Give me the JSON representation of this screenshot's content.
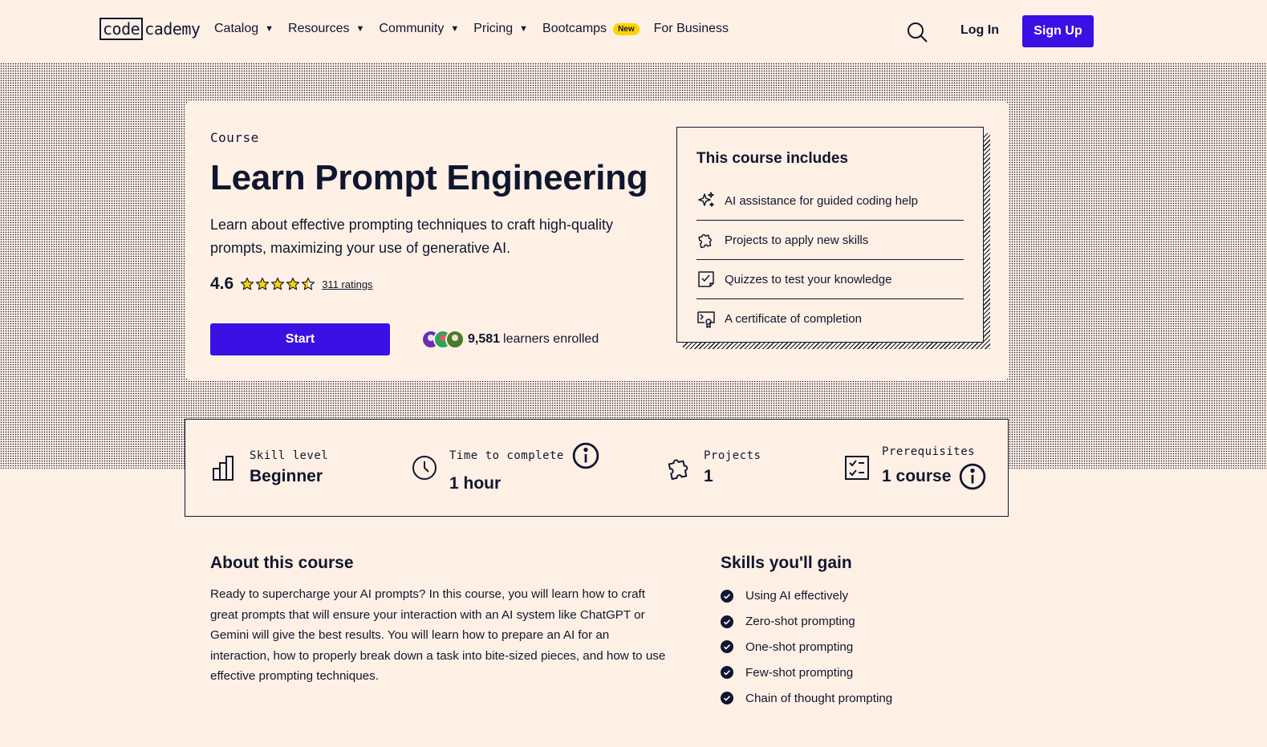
{
  "header": {
    "logo_code": "code",
    "logo_rest": "cademy",
    "nav": [
      {
        "label": "Catalog",
        "caret": true
      },
      {
        "label": "Resources",
        "caret": true
      },
      {
        "label": "Community",
        "caret": true
      },
      {
        "label": "Pricing",
        "caret": true
      },
      {
        "label": "Bootcamps",
        "caret": false,
        "badge": "New"
      },
      {
        "label": "For Business",
        "caret": false
      }
    ],
    "login_label": "Log In",
    "signup_label": "Sign Up",
    "search_icon": "search-icon"
  },
  "hero": {
    "kicker": "Course",
    "title": "Learn Prompt Engineering",
    "description": "Learn about effective prompting techniques to craft high-quality prompts, maximizing your use of generative AI.",
    "rating": "4.6",
    "stars_filled": 4.5,
    "ratings_link": "311 ratings",
    "start_label": "Start",
    "enrolled_count": "9,581",
    "enrolled_text": "learners enrolled"
  },
  "includes": {
    "title": "This course includes",
    "items": [
      {
        "icon": "sparkle-icon",
        "label": "AI assistance for guided coding help"
      },
      {
        "icon": "puzzle-icon",
        "label": "Projects to apply new skills"
      },
      {
        "icon": "quiz-icon",
        "label": "Quizzes to test your knowledge"
      },
      {
        "icon": "certificate-icon",
        "label": "A certificate of completion"
      }
    ]
  },
  "stats": [
    {
      "icon": "bar-chart-icon",
      "label": "Skill level",
      "value": "Beginner",
      "info_on_label": false,
      "info_on_value": false
    },
    {
      "icon": "clock-icon",
      "label": "Time to complete",
      "value": "1 hour",
      "info_on_label": true,
      "info_on_value": false
    },
    {
      "icon": "puzzle-icon",
      "label": "Projects",
      "value": "1",
      "info_on_label": false,
      "info_on_value": false
    },
    {
      "icon": "checklist-icon",
      "label": "Prerequisites",
      "value": "1 course",
      "info_on_label": false,
      "info_on_value": true
    }
  ],
  "about": {
    "title": "About this course",
    "text": "Ready to supercharge your AI prompts? In this course, you will learn how to craft great prompts that will ensure your interaction with an AI system like ChatGPT or Gemini will give the best results. You will learn how to prepare an AI for an interaction, how to properly break down a task into bite-sized pieces, and how to use effective prompting techniques."
  },
  "skills": {
    "title": "Skills you'll gain",
    "items": [
      "Using AI effectively",
      "Zero-shot prompting",
      "One-shot prompting",
      "Few-shot prompting",
      "Chain of thought prompting"
    ]
  },
  "colors": {
    "background": "#fff0e5",
    "text": "#10162f",
    "primary": "#3a10e5",
    "star": "#ffd300",
    "badge": "#ffd300"
  }
}
